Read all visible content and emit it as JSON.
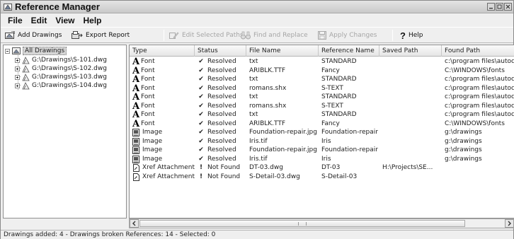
{
  "window": {
    "title": "Reference Manager"
  },
  "menu": [
    "File",
    "Edit",
    "View",
    "Help"
  ],
  "toolbar": {
    "add_drawings": "Add Drawings",
    "export_report": "Export Report",
    "edit_selected_paths": "Edit Selected Paths",
    "find_and_replace": "Find and Replace",
    "apply_changes": "Apply Changes",
    "help": "Help"
  },
  "tree": {
    "root": "All Drawings",
    "drawings": [
      "G:\\Drawings\\S-101.dwg",
      "G:\\Drawings\\S-102.dwg",
      "G:\\Drawings\\S-103.dwg",
      "G:\\Drawings\\S-104.dwg"
    ]
  },
  "columns": [
    "Type",
    "Status",
    "File Name",
    "Reference Name",
    "Saved Path",
    "Found Path"
  ],
  "rows": [
    {
      "icon": "font-icon",
      "type": "Font",
      "status_icon": "check-icon",
      "status": "Resolved",
      "file": "txt",
      "ref": "STANDARD",
      "saved": "",
      "found": "c:\\program files\\autocad"
    },
    {
      "icon": "font-icon",
      "type": "Font",
      "status_icon": "check-icon",
      "status": "Resolved",
      "file": "ARIBLK.TTF",
      "ref": "Fancy",
      "saved": "",
      "found": "C:\\WINDOWS\\fonts"
    },
    {
      "icon": "font-icon",
      "type": "Font",
      "status_icon": "check-icon",
      "status": "Resolved",
      "file": "txt",
      "ref": "STANDARD",
      "saved": "",
      "found": "c:\\program files\\autocad"
    },
    {
      "icon": "font-icon",
      "type": "Font",
      "status_icon": "check-icon",
      "status": "Resolved",
      "file": "romans.shx",
      "ref": "S-TEXT",
      "saved": "",
      "found": "c:\\program files\\autocad"
    },
    {
      "icon": "font-icon",
      "type": "Font",
      "status_icon": "check-icon",
      "status": "Resolved",
      "file": "txt",
      "ref": "STANDARD",
      "saved": "",
      "found": "c:\\program files\\autocad"
    },
    {
      "icon": "font-icon",
      "type": "Font",
      "status_icon": "check-icon",
      "status": "Resolved",
      "file": "romans.shx",
      "ref": "S-TEXT",
      "saved": "",
      "found": "c:\\program files\\autocad"
    },
    {
      "icon": "font-icon",
      "type": "Font",
      "status_icon": "check-icon",
      "status": "Resolved",
      "file": "txt",
      "ref": "STANDARD",
      "saved": "",
      "found": "c:\\program files\\autocad"
    },
    {
      "icon": "font-icon",
      "type": "Font",
      "status_icon": "check-icon",
      "status": "Resolved",
      "file": "ARIBLK.TTF",
      "ref": "Fancy",
      "saved": "",
      "found": "C:\\WINDOWS\\fonts"
    },
    {
      "icon": "image-icon",
      "type": "Image",
      "status_icon": "check-icon",
      "status": "Resolved",
      "file": "Foundation-repair.jpg",
      "ref": "Foundation-repair",
      "saved": "",
      "found": "g:\\drawings"
    },
    {
      "icon": "image-icon",
      "type": "Image",
      "status_icon": "check-icon",
      "status": "Resolved",
      "file": "Iris.tif",
      "ref": "Iris",
      "saved": "",
      "found": "g:\\drawings"
    },
    {
      "icon": "image-icon",
      "type": "Image",
      "status_icon": "check-icon",
      "status": "Resolved",
      "file": "Foundation-repair.jpg",
      "ref": "Foundation-repair",
      "saved": "",
      "found": "g:\\drawings"
    },
    {
      "icon": "image-icon",
      "type": "Image",
      "status_icon": "check-icon",
      "status": "Resolved",
      "file": "Iris.tif",
      "ref": "Iris",
      "saved": "",
      "found": "g:\\drawings"
    },
    {
      "icon": "xref-icon",
      "type": "Xref Attachment",
      "status_icon": "warning-icon",
      "status": "Not Found",
      "file": "DT-03.dwg",
      "ref": "DT-03",
      "saved": "H:\\Projects\\SE...",
      "found": ""
    },
    {
      "icon": "xref-icon",
      "type": "Xref Attachment",
      "status_icon": "warning-icon",
      "status": "Not Found",
      "file": "S-Detail-03.dwg",
      "ref": "S-Detail-03",
      "saved": "",
      "found": ""
    }
  ],
  "statusbar": {
    "text": "Drawings added: 4 - Drawings broken References: 14 - Selected: 0"
  }
}
